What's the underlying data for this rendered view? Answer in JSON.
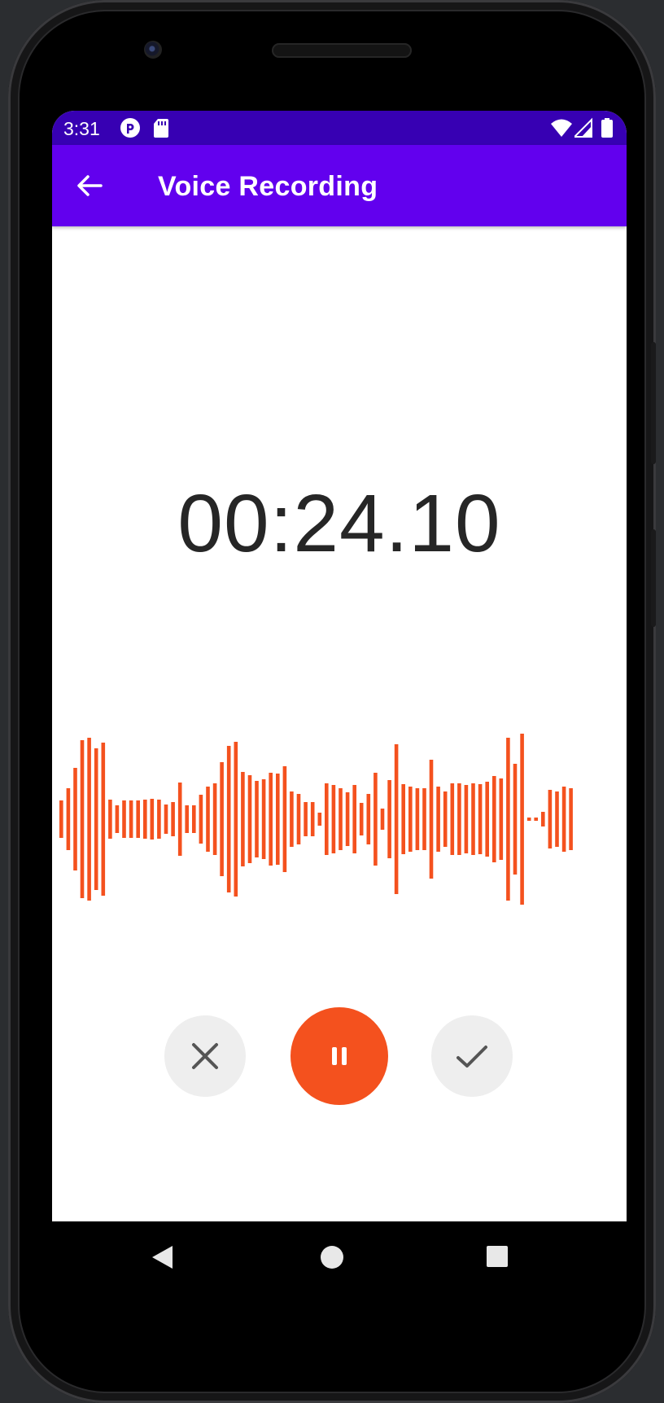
{
  "status_bar": {
    "time": "3:31",
    "icons": [
      "pocket-casts-icon",
      "sd-card-icon",
      "wifi-icon",
      "cell-signal-icon",
      "battery-icon"
    ]
  },
  "toolbar": {
    "title": "Voice Recording",
    "back_icon": "arrow-left-icon"
  },
  "recording": {
    "elapsed": "00:24.10"
  },
  "waveform": {
    "color": "#f4511e",
    "levels": [
      0.23,
      0.38,
      0.63,
      0.97,
      1.0,
      0.87,
      0.94,
      0.24,
      0.17,
      0.23,
      0.23,
      0.23,
      0.24,
      0.25,
      0.24,
      0.18,
      0.21,
      0.45,
      0.17,
      0.17,
      0.3,
      0.4,
      0.44,
      0.7,
      0.9,
      0.95,
      0.58,
      0.54,
      0.47,
      0.49,
      0.57,
      0.56,
      0.65,
      0.34,
      0.31,
      0.21,
      0.21,
      0.08,
      0.44,
      0.42,
      0.38,
      0.33,
      0.42,
      0.2,
      0.31,
      0.57,
      0.13,
      0.48,
      0.92,
      0.43,
      0.4,
      0.38,
      0.38,
      0.73,
      0.4,
      0.34,
      0.44,
      0.44,
      0.42,
      0.44,
      0.43,
      0.46,
      0.53,
      0.5,
      1.0,
      0.68,
      1.05,
      0.02,
      0.02,
      0.09,
      0.36,
      0.34,
      0.4,
      0.38
    ],
    "brand": {
      "accent": "#f4511e",
      "toolbar": "#6200ee",
      "status": "#3700b3"
    }
  },
  "controls": {
    "cancel_icon": "close-icon",
    "pause_icon": "pause-icon",
    "done_icon": "check-icon"
  },
  "navigation": {
    "back_icon": "nav-back-icon",
    "home_icon": "nav-home-icon",
    "recents_icon": "nav-recents-icon"
  }
}
